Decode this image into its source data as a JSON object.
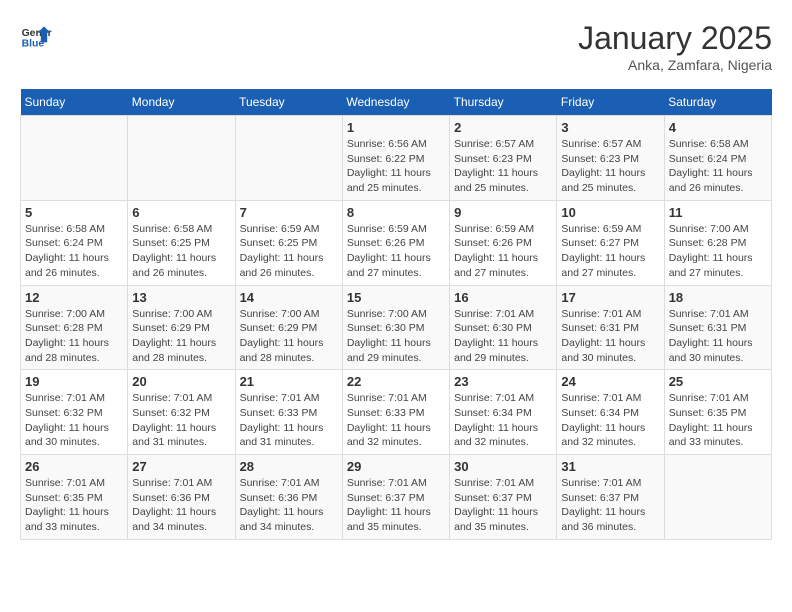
{
  "header": {
    "logo_line1": "General",
    "logo_line2": "Blue",
    "month": "January 2025",
    "location": "Anka, Zamfara, Nigeria"
  },
  "days_of_week": [
    "Sunday",
    "Monday",
    "Tuesday",
    "Wednesday",
    "Thursday",
    "Friday",
    "Saturday"
  ],
  "weeks": [
    [
      {
        "day": "",
        "info": ""
      },
      {
        "day": "",
        "info": ""
      },
      {
        "day": "",
        "info": ""
      },
      {
        "day": "1",
        "info": "Sunrise: 6:56 AM\nSunset: 6:22 PM\nDaylight: 11 hours\nand 25 minutes."
      },
      {
        "day": "2",
        "info": "Sunrise: 6:57 AM\nSunset: 6:23 PM\nDaylight: 11 hours\nand 25 minutes."
      },
      {
        "day": "3",
        "info": "Sunrise: 6:57 AM\nSunset: 6:23 PM\nDaylight: 11 hours\nand 25 minutes."
      },
      {
        "day": "4",
        "info": "Sunrise: 6:58 AM\nSunset: 6:24 PM\nDaylight: 11 hours\nand 26 minutes."
      }
    ],
    [
      {
        "day": "5",
        "info": "Sunrise: 6:58 AM\nSunset: 6:24 PM\nDaylight: 11 hours\nand 26 minutes."
      },
      {
        "day": "6",
        "info": "Sunrise: 6:58 AM\nSunset: 6:25 PM\nDaylight: 11 hours\nand 26 minutes."
      },
      {
        "day": "7",
        "info": "Sunrise: 6:59 AM\nSunset: 6:25 PM\nDaylight: 11 hours\nand 26 minutes."
      },
      {
        "day": "8",
        "info": "Sunrise: 6:59 AM\nSunset: 6:26 PM\nDaylight: 11 hours\nand 27 minutes."
      },
      {
        "day": "9",
        "info": "Sunrise: 6:59 AM\nSunset: 6:26 PM\nDaylight: 11 hours\nand 27 minutes."
      },
      {
        "day": "10",
        "info": "Sunrise: 6:59 AM\nSunset: 6:27 PM\nDaylight: 11 hours\nand 27 minutes."
      },
      {
        "day": "11",
        "info": "Sunrise: 7:00 AM\nSunset: 6:28 PM\nDaylight: 11 hours\nand 27 minutes."
      }
    ],
    [
      {
        "day": "12",
        "info": "Sunrise: 7:00 AM\nSunset: 6:28 PM\nDaylight: 11 hours\nand 28 minutes."
      },
      {
        "day": "13",
        "info": "Sunrise: 7:00 AM\nSunset: 6:29 PM\nDaylight: 11 hours\nand 28 minutes."
      },
      {
        "day": "14",
        "info": "Sunrise: 7:00 AM\nSunset: 6:29 PM\nDaylight: 11 hours\nand 28 minutes."
      },
      {
        "day": "15",
        "info": "Sunrise: 7:00 AM\nSunset: 6:30 PM\nDaylight: 11 hours\nand 29 minutes."
      },
      {
        "day": "16",
        "info": "Sunrise: 7:01 AM\nSunset: 6:30 PM\nDaylight: 11 hours\nand 29 minutes."
      },
      {
        "day": "17",
        "info": "Sunrise: 7:01 AM\nSunset: 6:31 PM\nDaylight: 11 hours\nand 30 minutes."
      },
      {
        "day": "18",
        "info": "Sunrise: 7:01 AM\nSunset: 6:31 PM\nDaylight: 11 hours\nand 30 minutes."
      }
    ],
    [
      {
        "day": "19",
        "info": "Sunrise: 7:01 AM\nSunset: 6:32 PM\nDaylight: 11 hours\nand 30 minutes."
      },
      {
        "day": "20",
        "info": "Sunrise: 7:01 AM\nSunset: 6:32 PM\nDaylight: 11 hours\nand 31 minutes."
      },
      {
        "day": "21",
        "info": "Sunrise: 7:01 AM\nSunset: 6:33 PM\nDaylight: 11 hours\nand 31 minutes."
      },
      {
        "day": "22",
        "info": "Sunrise: 7:01 AM\nSunset: 6:33 PM\nDaylight: 11 hours\nand 32 minutes."
      },
      {
        "day": "23",
        "info": "Sunrise: 7:01 AM\nSunset: 6:34 PM\nDaylight: 11 hours\nand 32 minutes."
      },
      {
        "day": "24",
        "info": "Sunrise: 7:01 AM\nSunset: 6:34 PM\nDaylight: 11 hours\nand 32 minutes."
      },
      {
        "day": "25",
        "info": "Sunrise: 7:01 AM\nSunset: 6:35 PM\nDaylight: 11 hours\nand 33 minutes."
      }
    ],
    [
      {
        "day": "26",
        "info": "Sunrise: 7:01 AM\nSunset: 6:35 PM\nDaylight: 11 hours\nand 33 minutes."
      },
      {
        "day": "27",
        "info": "Sunrise: 7:01 AM\nSunset: 6:36 PM\nDaylight: 11 hours\nand 34 minutes."
      },
      {
        "day": "28",
        "info": "Sunrise: 7:01 AM\nSunset: 6:36 PM\nDaylight: 11 hours\nand 34 minutes."
      },
      {
        "day": "29",
        "info": "Sunrise: 7:01 AM\nSunset: 6:37 PM\nDaylight: 11 hours\nand 35 minutes."
      },
      {
        "day": "30",
        "info": "Sunrise: 7:01 AM\nSunset: 6:37 PM\nDaylight: 11 hours\nand 35 minutes."
      },
      {
        "day": "31",
        "info": "Sunrise: 7:01 AM\nSunset: 6:37 PM\nDaylight: 11 hours\nand 36 minutes."
      },
      {
        "day": "",
        "info": ""
      }
    ]
  ]
}
